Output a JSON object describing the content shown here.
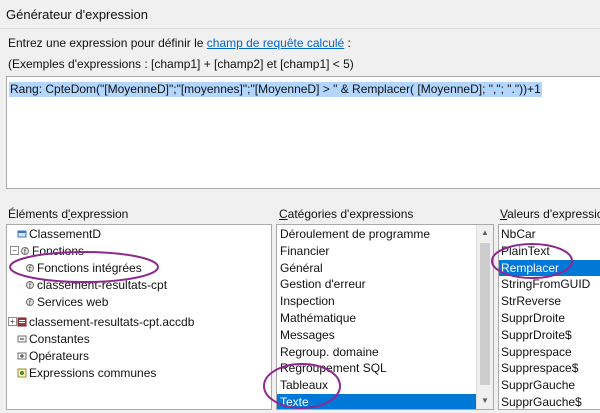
{
  "window": {
    "title": "Générateur d'expression"
  },
  "instructions": {
    "prefix": "Entrez une expression pour définir le ",
    "link": "champ de requête calculé",
    "suffix": " :"
  },
  "examples": "(Exemples d'expressions : [champ1] + [champ2] et [champ1] < 5)",
  "expression": "Rang: CpteDom(\"[MoyenneD]\";\"[moyennes]\";\"[MoyenneD] > \" & Remplacer( [MoyenneD]; \",\"; \".\"))+1",
  "sections": {
    "elements": {
      "pre": "Éléments d",
      "accel": "'",
      "post": "expression"
    },
    "categories": {
      "pre": "",
      "accel": "C",
      "post": "atégories d'expressions"
    },
    "values": {
      "pre": "",
      "accel": "V",
      "post": "aleurs d'expression"
    }
  },
  "elements_tree": [
    {
      "label": "ClassementD",
      "icon": "form-icon"
    },
    {
      "label": "Fonctions",
      "icon": "functions-icon",
      "expander": "−"
    },
    {
      "label": "Fonctions intégrées",
      "icon": "builtin-functions-icon"
    },
    {
      "label": "classement-resultats-cpt",
      "icon": "database-functions-icon"
    },
    {
      "label": "Services web",
      "icon": "web-services-icon"
    },
    {
      "label": "classement-resultats-cpt.accdb",
      "icon": "database-icon",
      "expander": "+"
    },
    {
      "label": "Constantes",
      "icon": "constants-icon"
    },
    {
      "label": "Opérateurs",
      "icon": "operators-icon"
    },
    {
      "label": "Expressions communes",
      "icon": "common-expressions-icon"
    }
  ],
  "categories": [
    "Déroulement de programme",
    "Financier",
    "Général",
    "Gestion d'erreur",
    "Inspection",
    "Mathématique",
    "Messages",
    "Regroup. domaine",
    "Regroupement SQL",
    "Tableaux",
    "Texte"
  ],
  "categories_selected": "Texte",
  "values": [
    "NbCar",
    "PlainText",
    "Remplacer",
    "StringFromGUID",
    "StrReverse",
    "SupprDroite",
    "SupprDroite$",
    "Supprespace",
    "Supprespace$",
    "SupprGauche",
    "SupprGauche$"
  ],
  "values_selected": "Remplacer",
  "colors": {
    "selection": "#0078d7",
    "expression_highlight": "#b3d6ff",
    "annotation": "#8e2a8e",
    "link": "#0066cc"
  }
}
